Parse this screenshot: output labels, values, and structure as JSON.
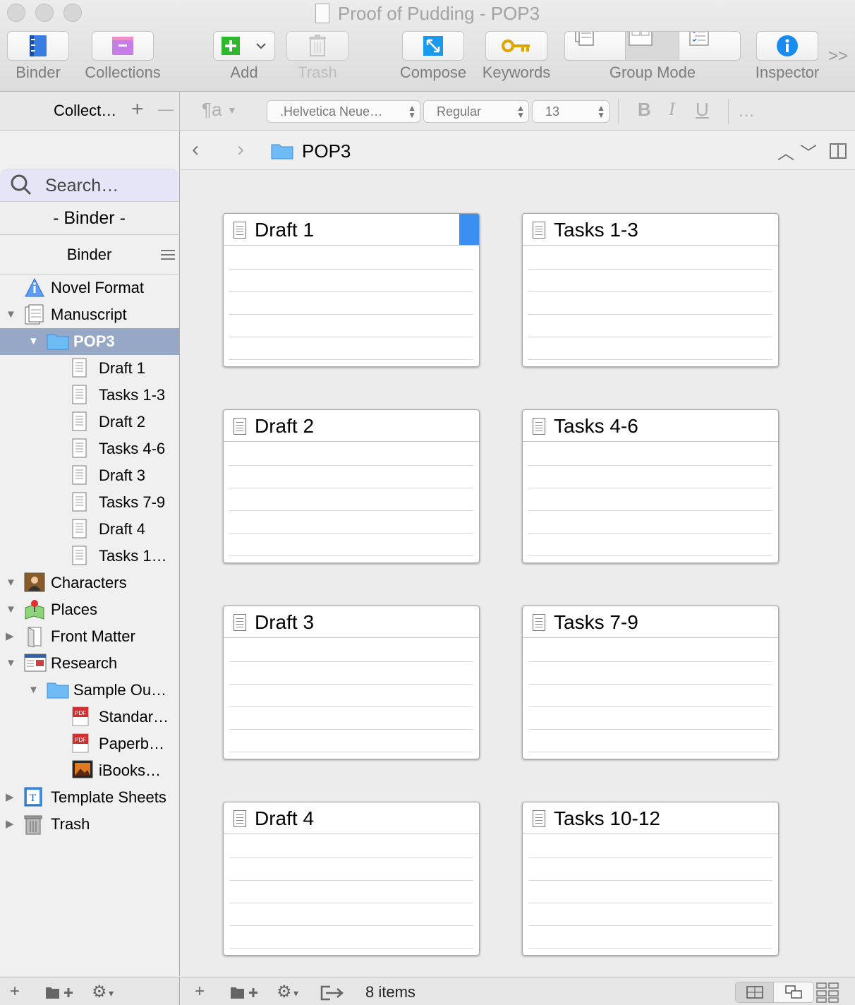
{
  "window": {
    "title": "Proof of Pudding - POP3"
  },
  "toolbar": {
    "binder": "Binder",
    "collections": "Collections",
    "add": "Add",
    "trash": "Trash",
    "compose": "Compose",
    "keywords": "Keywords",
    "group_mode": "Group Mode",
    "inspector": "Inspector",
    "overflow": ">>"
  },
  "formatbar": {
    "collections_label": "Collect…",
    "plus": "+",
    "minus": "—",
    "para_style": "¶a",
    "font_family": ".Helvetica Neue…",
    "font_weight": "Regular",
    "font_size": "13",
    "bold": "B",
    "italic": "I",
    "underline": "U",
    "more": "…"
  },
  "sidebar": {
    "search_placeholder": "Search…",
    "binder_separator": "- Binder -",
    "binder_header": "Binder",
    "tree": [
      {
        "label": "Novel Format",
        "icon": "info-icon",
        "disclosure": ""
      },
      {
        "label": "Manuscript",
        "icon": "manuscript-icon",
        "disclosure": "▼"
      },
      {
        "label": "POP3",
        "icon": "folder-icon",
        "disclosure": "▼"
      },
      {
        "label": "Draft 1",
        "icon": "document-icon",
        "disclosure": ""
      },
      {
        "label": "Tasks 1-3",
        "icon": "document-icon",
        "disclosure": ""
      },
      {
        "label": "Draft 2",
        "icon": "document-icon",
        "disclosure": ""
      },
      {
        "label": "Tasks 4-6",
        "icon": "document-icon",
        "disclosure": ""
      },
      {
        "label": "Draft 3",
        "icon": "document-icon",
        "disclosure": ""
      },
      {
        "label": "Tasks 7-9",
        "icon": "document-icon",
        "disclosure": ""
      },
      {
        "label": "Draft 4",
        "icon": "document-icon",
        "disclosure": ""
      },
      {
        "label": "Tasks 1…",
        "icon": "document-icon",
        "disclosure": ""
      },
      {
        "label": "Characters",
        "icon": "character-icon",
        "disclosure": "▼"
      },
      {
        "label": "Places",
        "icon": "map-pin-icon",
        "disclosure": "▼"
      },
      {
        "label": "Front Matter",
        "icon": "front-matter-icon",
        "disclosure": "▶"
      },
      {
        "label": "Research",
        "icon": "research-icon",
        "disclosure": "▼"
      },
      {
        "label": "Sample Ou…",
        "icon": "folder-icon",
        "disclosure": "▼"
      },
      {
        "label": "Standar…",
        "icon": "pdf-icon",
        "disclosure": ""
      },
      {
        "label": "Paperb…",
        "icon": "pdf-icon",
        "disclosure": ""
      },
      {
        "label": "iBooks…",
        "icon": "image-icon",
        "disclosure": ""
      },
      {
        "label": "Template Sheets",
        "icon": "template-icon",
        "disclosure": "▶"
      },
      {
        "label": "Trash",
        "icon": "trash-icon",
        "disclosure": "▶"
      }
    ],
    "selected_item": "POP3"
  },
  "pathbar": {
    "back": "‹",
    "forward": "›",
    "current": "POP3"
  },
  "corkboard": {
    "cards": [
      {
        "title": "Draft 1",
        "label_color": "#3b8ff0"
      },
      {
        "title": "Tasks 1-3"
      },
      {
        "title": "Draft 2"
      },
      {
        "title": "Tasks 4-6"
      },
      {
        "title": "Draft 3"
      },
      {
        "title": "Tasks 7-9"
      },
      {
        "title": "Draft 4"
      },
      {
        "title": "Tasks 10-12"
      }
    ]
  },
  "footer": {
    "item_count": "8 items"
  },
  "colors": {
    "selection": "#97a8c7",
    "label_blue": "#3b8ff0",
    "accent_add": "#2eb82e",
    "inspector_blue": "#1a8cf0",
    "keyword_gold": "#e0a400"
  }
}
